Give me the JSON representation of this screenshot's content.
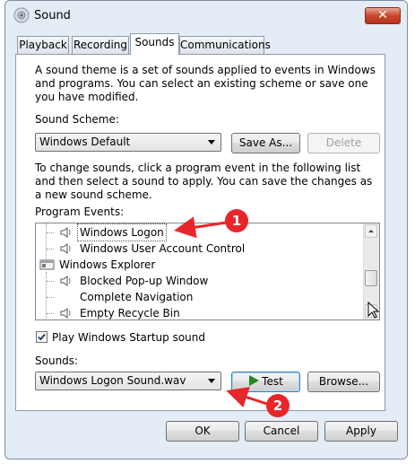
{
  "window": {
    "title": "Sound",
    "close_glyph": "✕"
  },
  "tabs": [
    {
      "label": "Playback",
      "active": false
    },
    {
      "label": "Recording",
      "active": false
    },
    {
      "label": "Sounds",
      "active": true
    },
    {
      "label": "Communications",
      "active": false
    }
  ],
  "sounds_tab": {
    "intro": "A sound theme is a set of sounds applied to events in Windows and programs.  You can select an existing scheme or save one you have modified.",
    "scheme_label": "Sound Scheme:",
    "scheme_value": "Windows Default",
    "save_as_label": "Save As...",
    "delete_label": "Delete",
    "change_text": "To change sounds, click a program event in the following list and then select a sound to apply.  You can save the changes as a new sound scheme.",
    "program_events_label": "Program Events:",
    "events": [
      {
        "label": "Windows Logon",
        "icon": "speaker-icon",
        "selected": true
      },
      {
        "label": "Windows User Account Control",
        "icon": "speaker-icon",
        "selected": false
      },
      {
        "label": "Windows Explorer",
        "icon": "explorer-window-icon",
        "selected": false
      },
      {
        "label": "Blocked Pop-up Window",
        "icon": "speaker-icon",
        "selected": false
      },
      {
        "label": "Complete Navigation",
        "icon": "none",
        "selected": false
      },
      {
        "label": "Empty Recycle Bin",
        "icon": "speaker-icon",
        "selected": false
      }
    ],
    "startup_sound_label": "Play Windows Startup sound",
    "startup_sound_checked": true,
    "sounds_label": "Sounds:",
    "sound_value": "Windows Logon Sound.wav",
    "test_label": "Test",
    "browse_label": "Browse..."
  },
  "footer": {
    "ok_label": "OK",
    "cancel_label": "Cancel",
    "apply_label": "Apply"
  },
  "annotations": [
    {
      "number": "1",
      "color": "#e8262a"
    },
    {
      "number": "2",
      "color": "#e8262a"
    }
  ]
}
